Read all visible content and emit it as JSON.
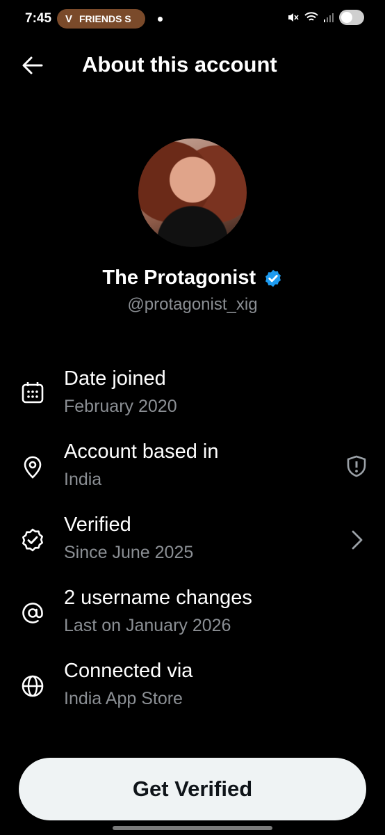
{
  "status_bar": {
    "time": "7:45",
    "notification_pill": "FRIENDS S",
    "pill_icon": "V"
  },
  "header": {
    "title": "About this account"
  },
  "profile": {
    "name": "The Protagonist",
    "handle": "@protagonist_xig",
    "verified_badge_color": "#1d9bf0"
  },
  "info": [
    {
      "icon": "calendar-icon",
      "label": "Date joined",
      "sub": "February 2020"
    },
    {
      "icon": "location-pin-icon",
      "label": "Account based in",
      "sub": "India",
      "right_icon": "shield-alert-icon"
    },
    {
      "icon": "verified-badge-outline-icon",
      "label": "Verified",
      "sub": "Since June 2025",
      "right_icon": "chevron-right-icon"
    },
    {
      "icon": "at-sign-icon",
      "label": "2 username changes",
      "sub": "Last on January 2026"
    },
    {
      "icon": "globe-icon",
      "label": "Connected via",
      "sub": "India App Store"
    }
  ],
  "cta": {
    "label": "Get Verified"
  },
  "colors": {
    "background": "#000000",
    "text_primary": "#e7e9ea",
    "text_secondary": "#8b8f94",
    "button_bg": "#eff3f4",
    "accent": "#1d9bf0"
  }
}
